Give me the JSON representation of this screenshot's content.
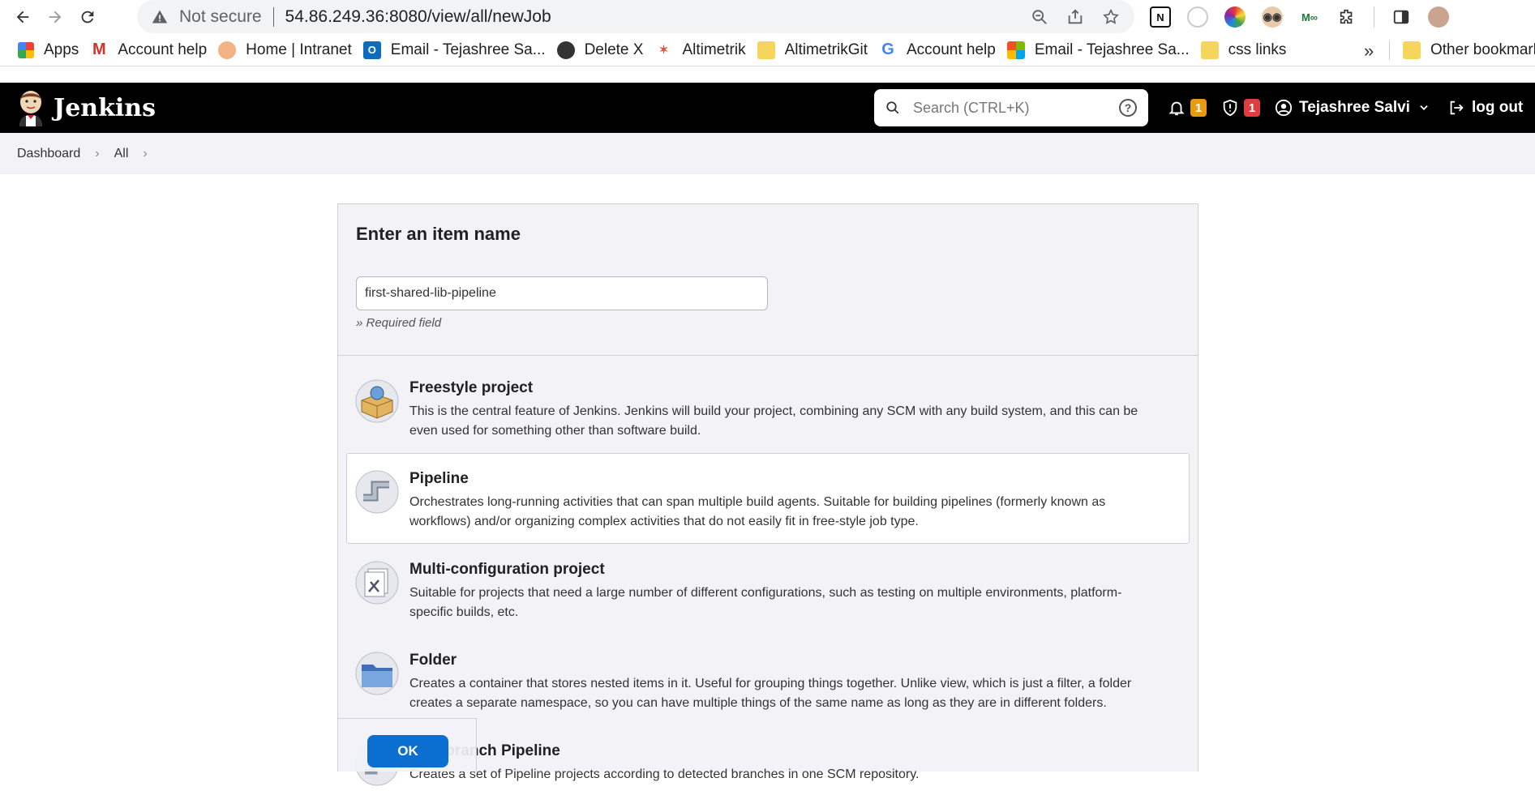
{
  "browser": {
    "security_label": "Not secure",
    "url": "54.86.249.36:8080/view/all/newJob"
  },
  "bookmarks": [
    {
      "label": "Apps",
      "icon": "apps-grid-icon"
    },
    {
      "label": "Account help",
      "icon": "gmail-icon"
    },
    {
      "label": "Home | Intranet",
      "icon": "sun-icon"
    },
    {
      "label": "Email - Tejashree Sa...",
      "icon": "outlook-icon"
    },
    {
      "label": "Delete X",
      "icon": "globe-icon"
    },
    {
      "label": "Altimetrik",
      "icon": "altimetrik-icon"
    },
    {
      "label": "AltimetrikGit",
      "icon": "folder-icon"
    },
    {
      "label": "Account help",
      "icon": "google-icon"
    },
    {
      "label": "Email - Tejashree Sa...",
      "icon": "microsoft-icon"
    },
    {
      "label": "css links",
      "icon": "folder-icon"
    }
  ],
  "bookmarks_more": "»",
  "bookmarks_other": "Other bookmarks",
  "jenkins": {
    "title": "Jenkins",
    "search_placeholder": "Search (CTRL+K)",
    "notifications_count": "1",
    "security_count": "1",
    "user": "Tejashree Salvi",
    "logout": "log out"
  },
  "breadcrumb": [
    "Dashboard",
    "All"
  ],
  "form": {
    "heading": "Enter an item name",
    "item_name": "first-shared-lib-pipeline",
    "required_note": "» Required field",
    "ok_label": "OK"
  },
  "item_types": [
    {
      "name": "Freestyle project",
      "desc": "This is the central feature of Jenkins. Jenkins will build your project, combining any SCM with any build system, and this can be even used for something other than software build.",
      "selected": false
    },
    {
      "name": "Pipeline",
      "desc": "Orchestrates long-running activities that can span multiple build agents. Suitable for building pipelines (formerly known as workflows) and/or organizing complex activities that do not easily fit in free-style job type.",
      "selected": true
    },
    {
      "name": "Multi-configuration project",
      "desc": "Suitable for projects that need a large number of different configurations, such as testing on multiple environments, platform-specific builds, etc.",
      "selected": false
    },
    {
      "name": "Folder",
      "desc": "Creates a container that stores nested items in it. Useful for grouping things together. Unlike view, which is just a filter, a folder creates a separate namespace, so you can have multiple things of the same name as long as they are in different folders.",
      "selected": false
    },
    {
      "name": "Multibranch Pipeline",
      "desc": "Creates a set of Pipeline projects according to detected branches in one SCM repository.",
      "selected": false
    }
  ]
}
